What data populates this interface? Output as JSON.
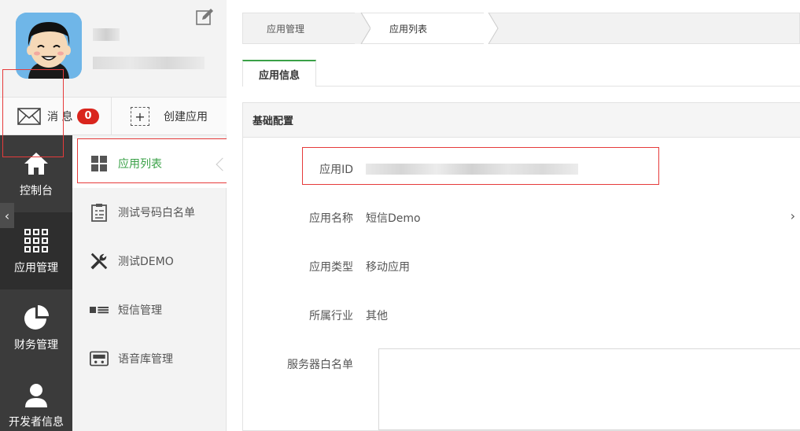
{
  "profile": {
    "username_blurred": "",
    "email_blurred": ""
  },
  "actions": {
    "messages_label": "消 息",
    "messages_count": "0",
    "create_app_label": "创建应用",
    "create_icon": "+"
  },
  "nav": {
    "items": [
      {
        "label": "控制台",
        "icon": "home-icon"
      },
      {
        "label": "应用管理",
        "icon": "grid-icon"
      },
      {
        "label": "财务管理",
        "icon": "pie-chart-icon"
      },
      {
        "label": "开发者信息",
        "icon": "user-icon"
      }
    ],
    "collapse_glyph": "‹"
  },
  "submenu": {
    "items": [
      {
        "label": "应用列表",
        "icon": "app-list-icon"
      },
      {
        "label": "测试号码白名单",
        "icon": "clipboard-icon"
      },
      {
        "label": "测试DEMO",
        "icon": "tools-icon"
      },
      {
        "label": "短信管理",
        "icon": "sms-icon"
      },
      {
        "label": "语音库管理",
        "icon": "voice-library-icon"
      }
    ]
  },
  "breadcrumb": [
    "应用管理",
    "应用列表"
  ],
  "tabs": [
    {
      "label": "应用信息"
    }
  ],
  "panel": {
    "title": "基础配置",
    "fields": [
      {
        "key": "应用ID",
        "value": ""
      },
      {
        "key": "应用名称",
        "value": "短信Demo"
      },
      {
        "key": "应用类型",
        "value": "移动应用"
      },
      {
        "key": "所属行业",
        "value": "其他"
      },
      {
        "key": "服务器白名单",
        "value": ""
      }
    ],
    "more_glyph": "›"
  },
  "colors": {
    "accent": "#3aa147",
    "badge": "#d9251d",
    "nav_bg": "#3b3b3b",
    "annotation": "#e63b3b"
  }
}
